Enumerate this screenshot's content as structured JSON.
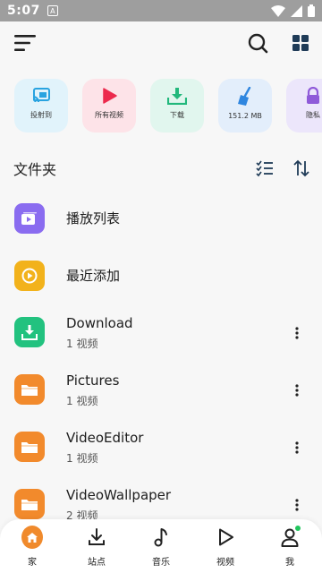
{
  "status_bar": {
    "time": "5:07",
    "notification_icon": "a-square-icon",
    "icons": [
      "wifi-icon",
      "signal-icon",
      "battery-icon"
    ]
  },
  "app_bar": {
    "icons": [
      "menu-icon",
      "search-icon",
      "grid-view-icon"
    ]
  },
  "tiles": [
    {
      "label": "投射到",
      "icon": "cast-icon",
      "bg": "#e1f3fb",
      "color": "#29a3e0"
    },
    {
      "label": "所有视频",
      "icon": "play-icon",
      "bg": "#fde3e8",
      "color": "#ec2a4d"
    },
    {
      "label": "下载",
      "icon": "download-icon",
      "bg": "#e1f6ee",
      "color": "#22b87c"
    },
    {
      "label": "151.2 MB",
      "icon": "broom-icon",
      "bg": "#e3eefb",
      "color": "#2f86df"
    },
    {
      "label": "隐私",
      "icon": "lock-icon",
      "bg": "#ece6fb",
      "color": "#8f5ad9"
    }
  ],
  "section": {
    "title": "文件夹",
    "icons": [
      "checklist-icon",
      "sort-arrows-icon"
    ]
  },
  "folders": [
    {
      "name": "播放列表",
      "count": "",
      "icon": "playlist-icon",
      "color": "#8a6cf0",
      "more": false
    },
    {
      "name": "最近添加",
      "count": "",
      "icon": "clock-play-icon",
      "color": "#f2b21b",
      "more": false
    },
    {
      "name": "Download",
      "count": "1 视频",
      "icon": "download-folder-icon",
      "color": "#22c27f",
      "more": true
    },
    {
      "name": "Pictures",
      "count": "1 视频",
      "icon": "folder-icon",
      "color": "#f28a2c",
      "more": true
    },
    {
      "name": "VideoEditor",
      "count": "1 视频",
      "icon": "folder-icon",
      "color": "#f28a2c",
      "more": true
    },
    {
      "name": "VideoWallpaper",
      "count": "2 视频",
      "icon": "folder-icon",
      "color": "#f28a2c",
      "more": true
    }
  ],
  "bottom_nav": [
    {
      "label": "家",
      "icon": "home-icon",
      "active": true
    },
    {
      "label": "站点",
      "icon": "download-icon",
      "active": false
    },
    {
      "label": "音乐",
      "icon": "music-note-icon",
      "active": false
    },
    {
      "label": "视频",
      "icon": "play-outline-icon",
      "active": false
    },
    {
      "label": "我",
      "icon": "profile-icon",
      "active": false
    }
  ],
  "accent_color": "#f08a2c"
}
